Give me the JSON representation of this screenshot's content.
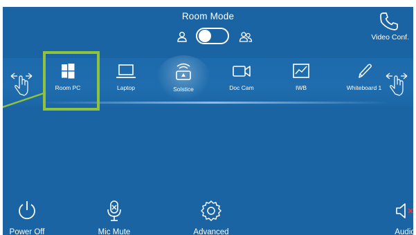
{
  "room_mode": {
    "title": "Room Mode"
  },
  "video_conf": {
    "label": "Video Conf."
  },
  "sources": [
    {
      "label": "Room PC",
      "icon": "windows-icon"
    },
    {
      "label": "Laptop",
      "icon": "laptop-icon"
    },
    {
      "label": "Solstice",
      "icon": "solstice-icon"
    },
    {
      "label": "Doc Cam",
      "icon": "doc-cam-icon"
    },
    {
      "label": "IWB",
      "icon": "iwb-icon"
    },
    {
      "label": "Whiteboard 1",
      "icon": "pen-icon"
    }
  ],
  "bottom": {
    "power": "Power Off",
    "mic": "Mic Mute",
    "advanced": "Advanced",
    "audio": "Audio"
  },
  "colors": {
    "background": "#1a64a4",
    "highlight": "#8fc23f",
    "mute_x": "#e53935"
  }
}
